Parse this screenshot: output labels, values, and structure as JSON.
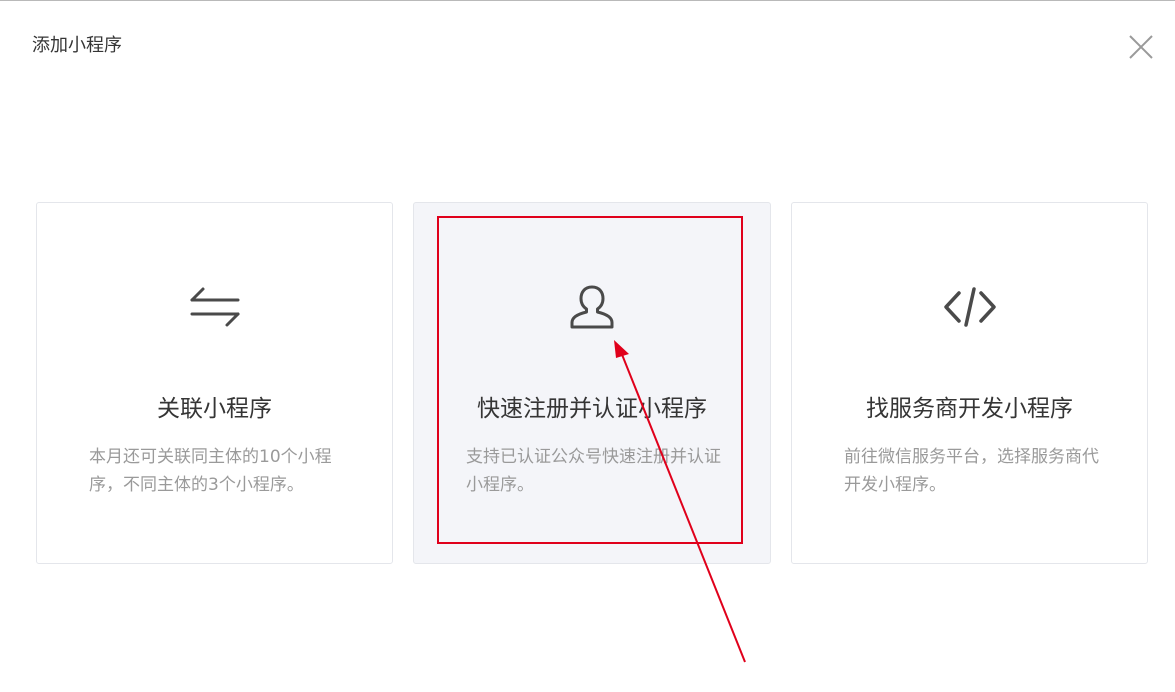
{
  "dialog": {
    "title": "添加小程序",
    "close_icon": "close-icon"
  },
  "cards": [
    {
      "icon": "swap-arrows-icon",
      "title": "关联小程序",
      "description": "本月还可关联同主体的10个小程序，不同主体的3个小程序。"
    },
    {
      "icon": "user-icon",
      "title": "快速注册并认证小程序",
      "description": "支持已认证公众号快速注册并认证小程序。"
    },
    {
      "icon": "code-icon",
      "title": "找服务商开发小程序",
      "description": "前往微信服务平台，选择服务商代开发小程序。"
    }
  ],
  "annotation": {
    "highlight_color": "#e0001b",
    "arrow_color": "#e0001b"
  }
}
